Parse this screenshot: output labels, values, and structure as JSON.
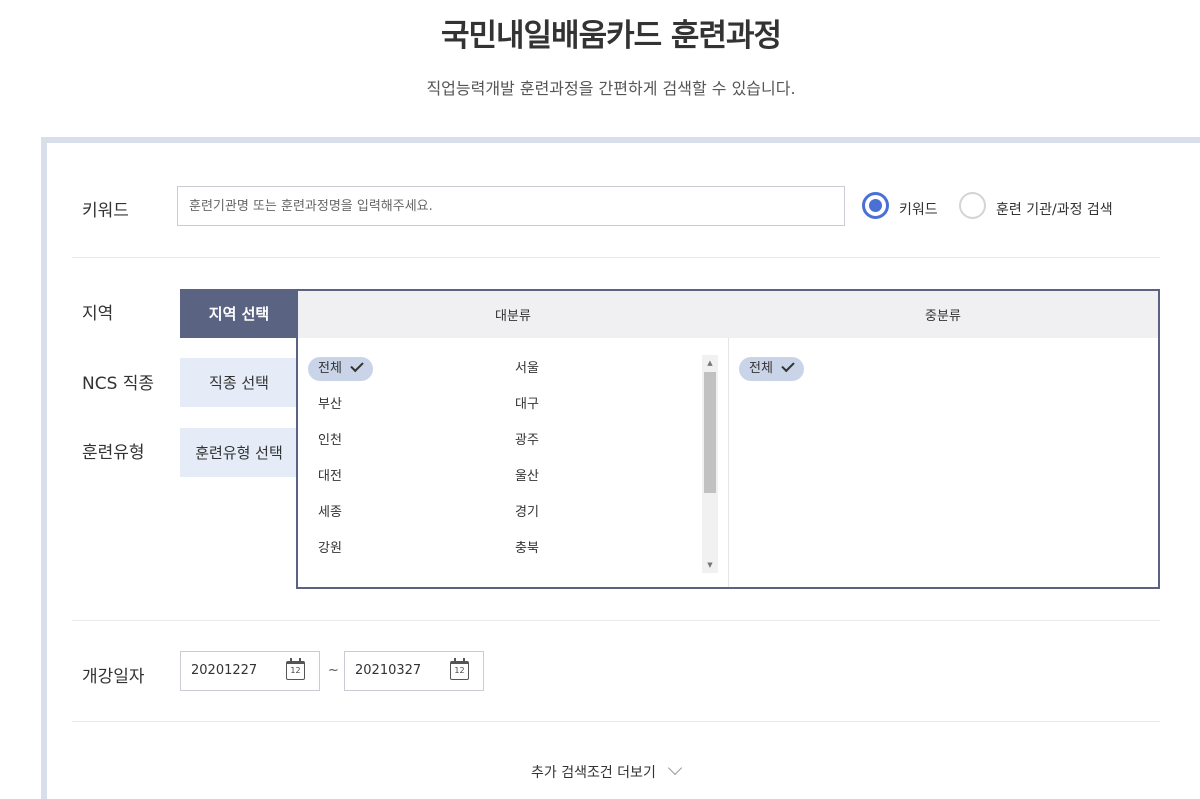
{
  "header": {
    "title": "국민내일배움카드 훈련과정",
    "subtitle": "직업능력개발 훈련과정을 간편하게 검색할 수 있습니다."
  },
  "keyword": {
    "label": "키워드",
    "placeholder": "훈련기관명 또는 훈련과정명을 입력해주세요.",
    "value": "",
    "options": [
      {
        "label": "키워드",
        "checked": true
      },
      {
        "label": "훈련 기관/과정 검색",
        "checked": false
      }
    ]
  },
  "filters": {
    "labels": [
      "지역",
      "NCS 직종",
      "훈련유형"
    ],
    "tabs": [
      {
        "label": "지역 선택",
        "active": true
      },
      {
        "label": "직종 선택",
        "active": false
      },
      {
        "label": "훈련유형 선택",
        "active": false
      }
    ]
  },
  "picker": {
    "major_header": "대분류",
    "minor_header": "중분류",
    "major_items": [
      "전체",
      "서울",
      "부산",
      "대구",
      "인천",
      "광주",
      "대전",
      "울산",
      "세종",
      "경기",
      "강원",
      "충북"
    ],
    "major_selected": "전체",
    "minor_items": [
      "전체"
    ],
    "minor_selected": "전체"
  },
  "dates": {
    "label": "개강일자",
    "start": "20201227",
    "end": "20210327",
    "separator": "~",
    "calendar_icon_text": "12"
  },
  "more": {
    "label": "추가 검색조건 더보기"
  },
  "colors": {
    "accent": "#4a70d6",
    "active_tab": "#5a6482",
    "inactive_tab": "#e5ecf7",
    "chip": "#c9d4e8",
    "panel_border": "#d9dfea"
  }
}
